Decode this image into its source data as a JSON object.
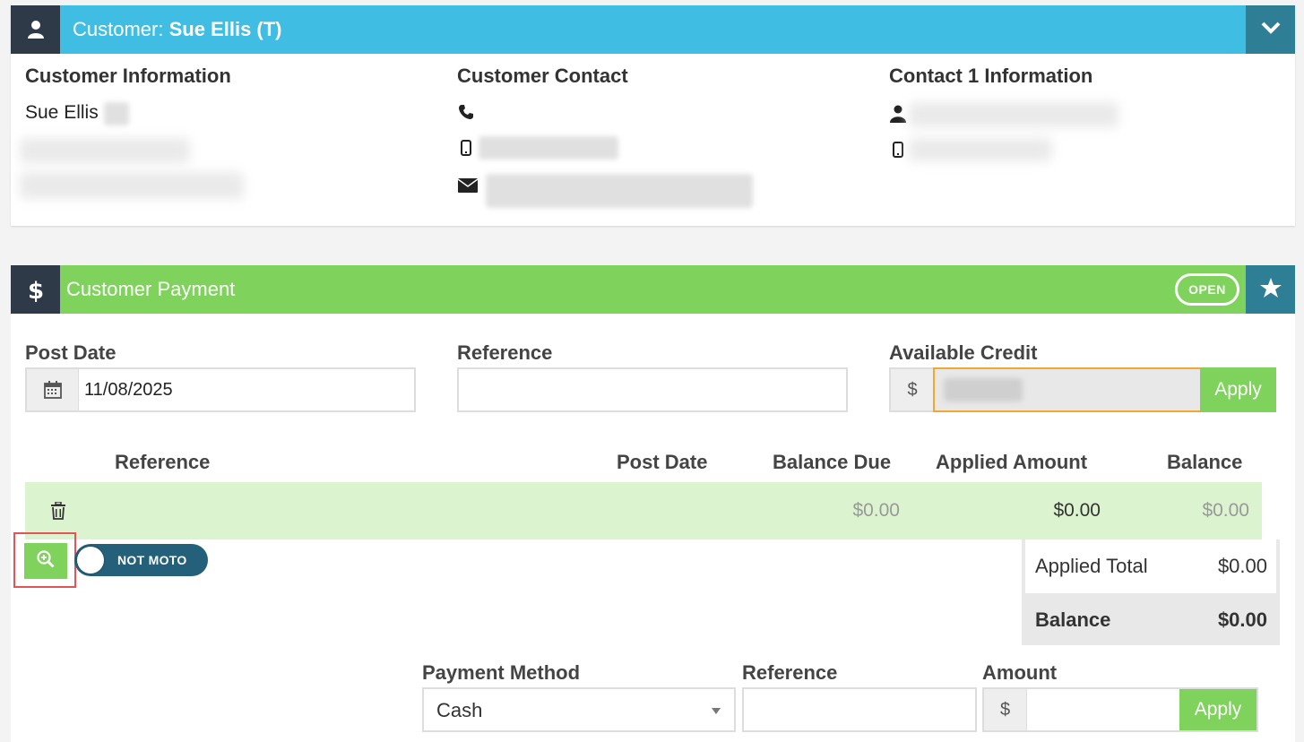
{
  "customer": {
    "label": "Customer: ",
    "name": "Sue Ellis (T)",
    "info_title": "Customer Information",
    "info_name": "Sue Ellis",
    "contact_title": "Customer Contact",
    "contact1_title": "Contact 1 Information"
  },
  "payment": {
    "title": "Customer Payment",
    "status_badge": "OPEN",
    "post_date_label": "Post Date",
    "post_date_value": "11/08/2025",
    "reference_label": "Reference",
    "available_credit_label": "Available Credit",
    "currency_symbol": "$",
    "apply_label": "Apply",
    "table": {
      "headers": {
        "reference": "Reference",
        "post_date": "Post Date",
        "balance_due": "Balance Due",
        "applied_amount": "Applied Amount",
        "balance": "Balance"
      },
      "row": {
        "balance_due": "$0.00",
        "applied_amount": "$0.00",
        "balance": "$0.00"
      }
    },
    "moto_toggle_label": "NOT MOTO",
    "totals": {
      "applied_total_label": "Applied Total",
      "applied_total_value": "$0.00",
      "balance_label": "Balance",
      "balance_value": "$0.00"
    },
    "method_label": "Payment Method",
    "method_value": "Cash",
    "method_reference_label": "Reference",
    "amount_label": "Amount"
  },
  "colors": {
    "blue_header": "#40bde3",
    "green_header": "#7fd25c",
    "dark_icon_box": "#2f3a49",
    "teal_box": "#2e7f96",
    "toggle": "#24607a",
    "row_highlight": "#dbf4cf",
    "zoom_highlight_border": "#e05555"
  },
  "icons": {
    "customer_header": "user-icon",
    "collapse": "chevron-down-icon",
    "payment_header": "dollar-icon",
    "favorite": "star-icon",
    "phone": "phone-icon",
    "mobile": "mobile-icon",
    "email": "envelope-icon",
    "contact_person": "user-icon",
    "calendar": "calendar-icon",
    "delete": "trash-icon",
    "zoom": "zoom-in-icon"
  }
}
